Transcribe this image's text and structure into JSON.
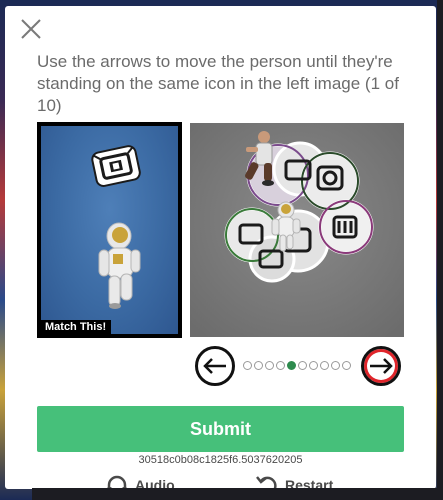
{
  "dialog": {
    "prompt": "Use the arrows to move the person until they're standing on the same icon in the left image (1 of 10)",
    "target_label": "Match This!",
    "submit_label": "Submit",
    "session_id": "30518c0b08c1825f6.5037620205",
    "audio_label": "Audio",
    "restart_label": "Restart"
  },
  "pagination": {
    "total": 10,
    "current": 5
  },
  "colors": {
    "submit": "#46c07a",
    "active_dot": "#2e8b4e",
    "next_ring": "#e0252b"
  },
  "icons": [
    "close-icon",
    "arrow-left-icon",
    "arrow-right-icon",
    "audio-icon",
    "restart-icon"
  ]
}
